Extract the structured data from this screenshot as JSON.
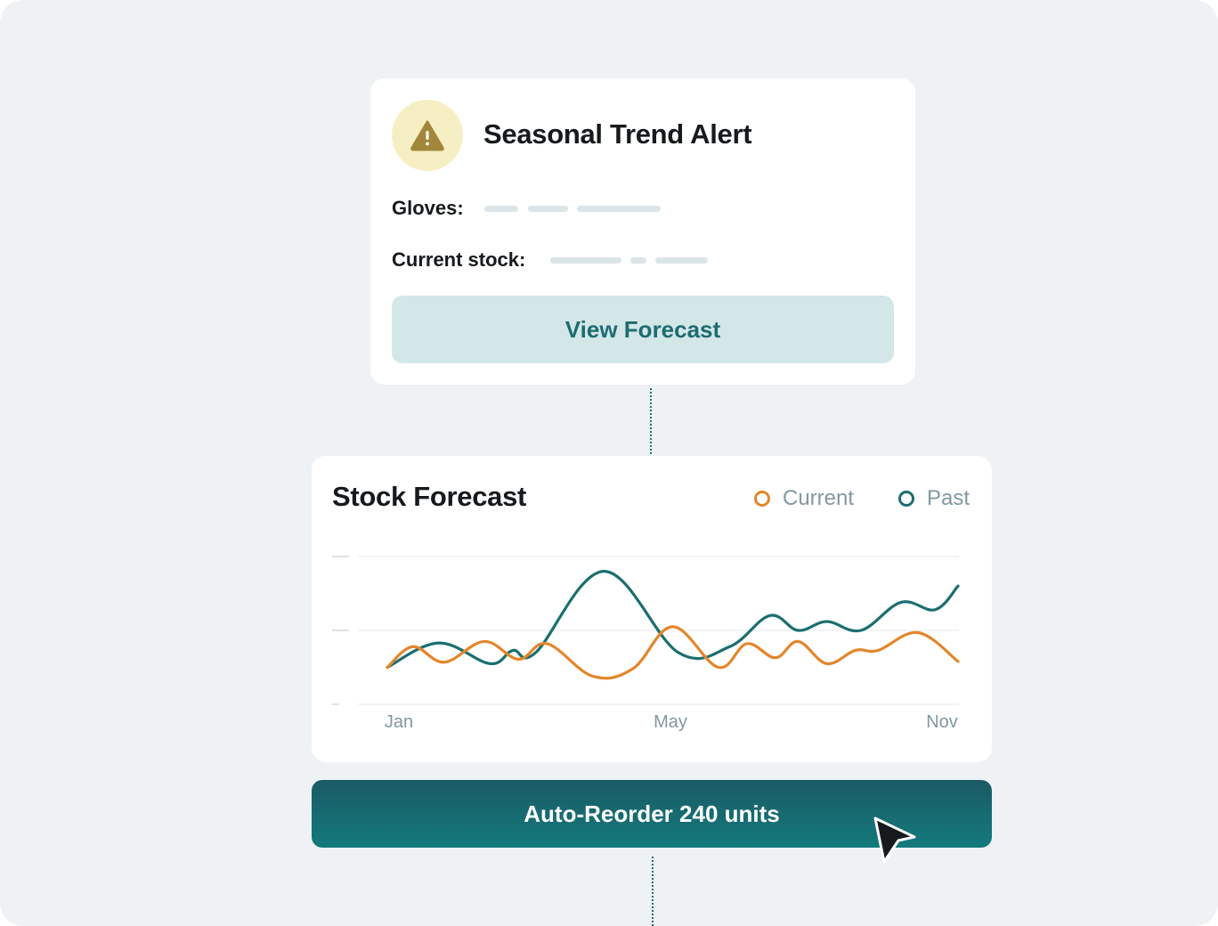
{
  "alert": {
    "title": "Seasonal Trend Alert",
    "icon": "warning-triangle-icon",
    "fields": [
      {
        "label": "Gloves:"
      },
      {
        "label": "Current stock:"
      }
    ],
    "button_label": "View Forecast"
  },
  "forecast": {
    "title": "Stock Forecast",
    "legend": [
      {
        "label": "Current",
        "color": "#e3862a"
      },
      {
        "label": "Past",
        "color": "#1b6e70"
      }
    ]
  },
  "chart_data": {
    "type": "line",
    "title": "Stock Forecast",
    "x_ticks": [
      "Jan",
      "May",
      "Nov"
    ],
    "x": [
      0,
      0.5,
      1,
      1.5,
      2,
      2.5,
      3,
      3.5,
      4,
      4.5,
      5,
      5.5,
      6,
      6.5,
      7,
      7.5,
      8,
      8.5,
      9,
      9.5,
      10,
      10.5
    ],
    "ylim": [
      0,
      2
    ],
    "grid": true,
    "legend_position": "top-right",
    "series": [
      {
        "name": "Current",
        "color": "#e3862a",
        "values": [
          0.5,
          0.78,
          0.57,
          0.85,
          0.61,
          0.82,
          0.38,
          0.48,
          1.05,
          0.5,
          0.82,
          0.63,
          0.85,
          0.55,
          0.73,
          0.73,
          0.97,
          0.58
        ]
      },
      {
        "name": "Past",
        "color": "#1b6e70",
        "values": [
          0.5,
          0.83,
          0.55,
          0.73,
          0.7,
          1.8,
          0.7,
          0.78,
          1.2,
          1.0,
          1.12,
          1.0,
          1.38,
          1.28,
          1.6
        ]
      }
    ],
    "current_x": [
      0,
      0.45,
      1,
      1.7,
      2.3,
      2.8,
      3.6,
      4.3,
      5.0,
      5.8,
      6.3,
      6.8,
      7.2,
      7.7,
      8.2,
      8.6,
      9.3,
      10.0
    ],
    "past_x": [
      0,
      0.9,
      1.8,
      2.2,
      2.6,
      3.8,
      5.1,
      6.0,
      6.7,
      7.2,
      7.7,
      8.3,
      9.0,
      9.6,
      10.0
    ]
  },
  "action": {
    "button_label": "Auto-Reorder 240 units"
  }
}
